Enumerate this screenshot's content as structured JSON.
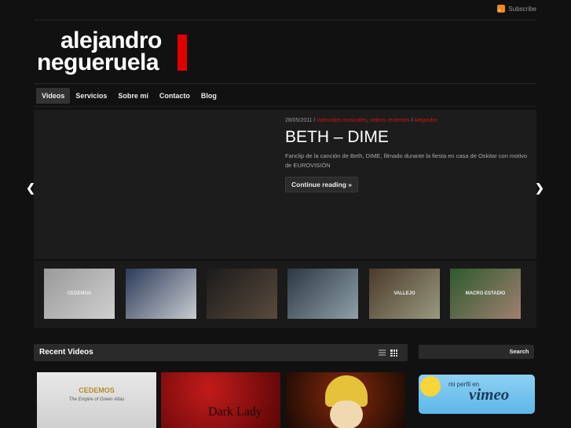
{
  "header": {
    "subscribe_label": "Subscribe",
    "logo_line1": "alejandro",
    "logo_line2": "negueruela"
  },
  "nav": {
    "items": [
      {
        "label": "Videos",
        "active": true
      },
      {
        "label": "Servicios"
      },
      {
        "label": "Sobre mí"
      },
      {
        "label": "Contacto"
      },
      {
        "label": "Blog"
      }
    ]
  },
  "slide": {
    "date": "28/05/2011",
    "separator": " / ",
    "cat1": "videoclips musicales",
    "comma": ", ",
    "cat2": "videos recientes",
    "separator2": " / ",
    "author": "Alejandro",
    "title": "BETH – DIME",
    "text": "Fanclip de la canción de Beth, DIME, filmado durante la fiesta en casa de Oskitar con motivo de EUROVISIÓN",
    "button": "Continue reading »"
  },
  "thumbnails": [
    {
      "name": "cedemos",
      "colors": [
        "#9a9a9a",
        "#cfcfcf"
      ],
      "caption": "CEDEMOS"
    },
    {
      "name": "jeans",
      "colors": [
        "#2d3b5a",
        "#c8ccd0"
      ]
    },
    {
      "name": "dark-man",
      "colors": [
        "#1b1b1b",
        "#5a4a3c"
      ]
    },
    {
      "name": "graffiti",
      "colors": [
        "#2c3842",
        "#8fa0a8"
      ]
    },
    {
      "name": "vallejo",
      "colors": [
        "#4b3a2a",
        "#9a9a80"
      ],
      "caption": "VALLEJO"
    },
    {
      "name": "stadium",
      "colors": [
        "#2e5a2e",
        "#a08070"
      ],
      "caption": "MACRO ESTADIO"
    }
  ],
  "recent": {
    "title": "Recent Videos"
  },
  "search": {
    "placeholder": "",
    "button": "Search"
  },
  "cards": [
    {
      "caption": "CEDEMOS",
      "subcaption": "The Empire of Green Atlas"
    },
    {
      "caption": "Dark Lady"
    },
    {
      "caption": ""
    }
  ],
  "vimeo": {
    "small": "mi perfil en",
    "big": "vimeo"
  },
  "colors": {
    "accent": "#e00000",
    "link_red": "#d31111",
    "bg": "#111111"
  }
}
